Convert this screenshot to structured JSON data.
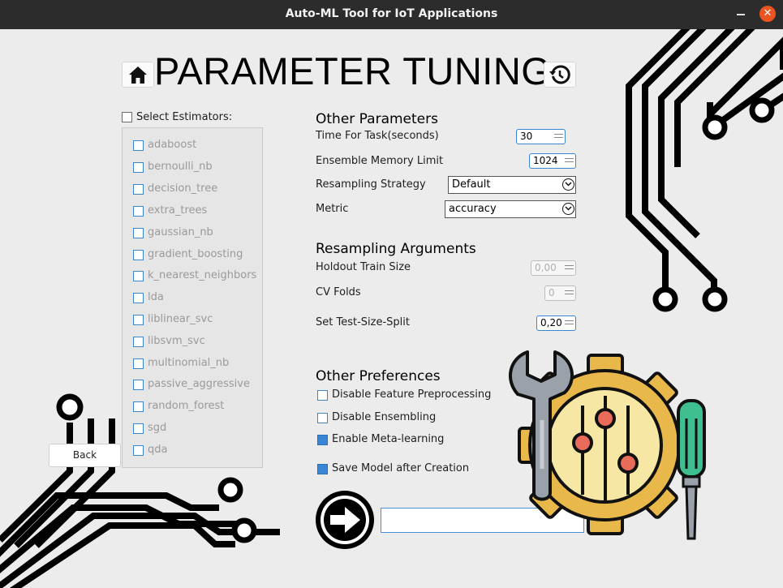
{
  "window": {
    "title": "Auto-ML Tool for IoT Applications",
    "close_glyph": "✕"
  },
  "header": {
    "title": "PARAMETER TUNING",
    "home_icon": "home-icon",
    "history_icon": "history-icon"
  },
  "estimators": {
    "select_all_label": "Select Estimators:",
    "select_all_checked": false,
    "items": [
      {
        "label": "adaboost",
        "checked": false
      },
      {
        "label": "bernoulli_nb",
        "checked": false
      },
      {
        "label": "decision_tree",
        "checked": false
      },
      {
        "label": "extra_trees",
        "checked": false
      },
      {
        "label": "gaussian_nb",
        "checked": false
      },
      {
        "label": "gradient_boosting",
        "checked": false
      },
      {
        "label": "k_nearest_neighbors",
        "checked": false
      },
      {
        "label": "lda",
        "checked": false
      },
      {
        "label": "liblinear_svc",
        "checked": false
      },
      {
        "label": "libsvm_svc",
        "checked": false
      },
      {
        "label": "multinomial_nb",
        "checked": false
      },
      {
        "label": "passive_aggressive",
        "checked": false
      },
      {
        "label": "random_forest",
        "checked": false
      },
      {
        "label": "sgd",
        "checked": false
      },
      {
        "label": "qda",
        "checked": false
      }
    ]
  },
  "other_parameters": {
    "heading": "Other Parameters",
    "time_label": "Time For Task(seconds)",
    "time_value": "30",
    "memory_label": "Ensemble Memory Limit",
    "memory_value": "1024",
    "resampling_label": "Resampling Strategy",
    "resampling_value": "Default",
    "metric_label": "Metric",
    "metric_value": "accuracy"
  },
  "resampling_arguments": {
    "heading": "Resampling Arguments",
    "holdout_label": "Holdout Train Size",
    "holdout_value": "0,00",
    "cv_label": "CV Folds",
    "cv_value": "0",
    "test_split_label": "Set Test-Size-Split",
    "test_split_value": "0,20"
  },
  "other_preferences": {
    "heading": "Other Preferences",
    "items": [
      {
        "label": "Disable Feature Preprocessing",
        "checked": false
      },
      {
        "label": "Disable Ensembling",
        "checked": false
      },
      {
        "label": "Enable Meta-learning",
        "checked": true
      },
      {
        "label": "Save Model after Creation",
        "checked": true
      }
    ]
  },
  "footer": {
    "back_label": "Back",
    "next_icon": "arrow-right-icon",
    "name_input_value": ""
  },
  "colors": {
    "accent": "#3a86d6",
    "titlebar": "#2c2c2c",
    "close": "#e95420",
    "gear": "#f7d36b",
    "gear_dark": "#e8b84a",
    "dial": "#e96b5a",
    "screwdriver": "#3fbf8f"
  }
}
